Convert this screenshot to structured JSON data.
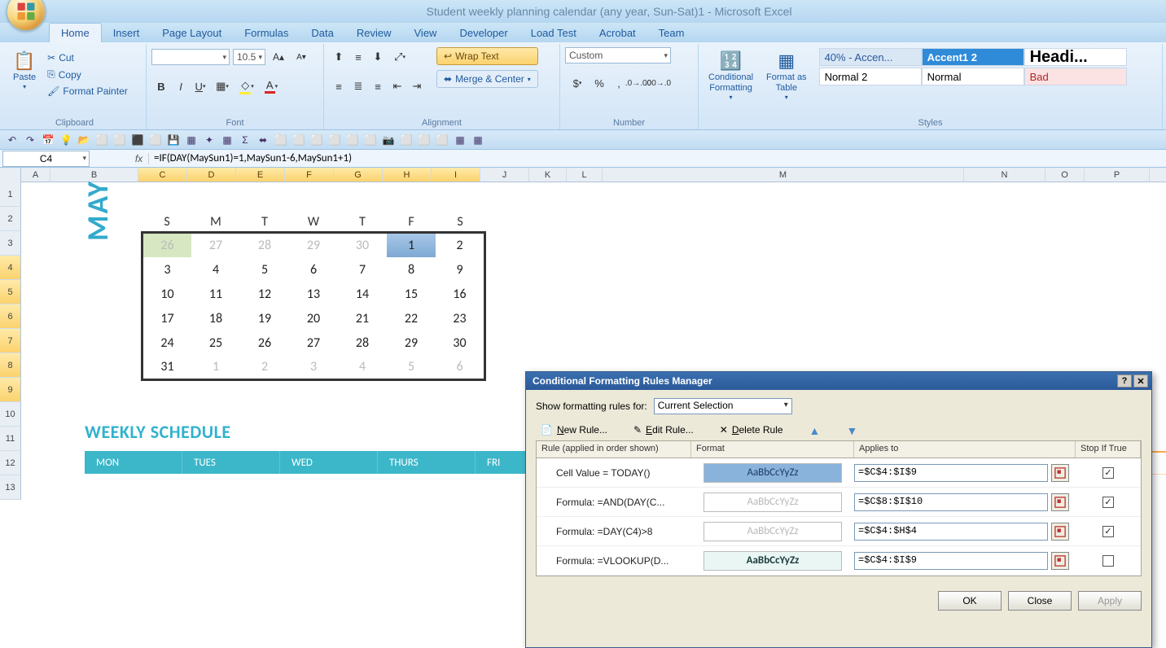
{
  "title": "Student weekly planning calendar (any year, Sun-Sat)1 - Microsoft Excel",
  "tabs": [
    "Home",
    "Insert",
    "Page Layout",
    "Formulas",
    "Data",
    "Review",
    "View",
    "Developer",
    "Load Test",
    "Acrobat",
    "Team"
  ],
  "active_tab": "Home",
  "clipboard": {
    "label": "Clipboard",
    "paste": "Paste",
    "cut": "Cut",
    "copy": "Copy",
    "fmtpainter": "Format Painter"
  },
  "font": {
    "label": "Font",
    "name": "",
    "size": "10.5"
  },
  "alignment": {
    "label": "Alignment",
    "wrap": "Wrap Text",
    "merge": "Merge & Center"
  },
  "number": {
    "label": "Number",
    "fmt": "Custom"
  },
  "stylesgrp": {
    "label": "Styles",
    "cond": "Conditional\nFormatting",
    "tbl": "Format as\nTable",
    "cells": [
      {
        "t": "40% - Accen...",
        "bg": "#d9e7f5",
        "fg": "#2b579a"
      },
      {
        "t": "Accent1 2",
        "bg": "#2f8bd8",
        "fg": "#fff",
        "bold": true
      },
      {
        "t": "Headi...",
        "bg": "#fff",
        "fg": "#000",
        "big": true,
        "bold": true
      },
      {
        "t": "Normal 2",
        "bg": "#fff",
        "fg": "#000"
      },
      {
        "t": "Normal",
        "bg": "#fff",
        "fg": "#000"
      },
      {
        "t": "Bad",
        "bg": "#fbe3e4",
        "fg": "#b02525"
      }
    ]
  },
  "namebox": "C4",
  "formula": "=IF(DAY(MaySun1)=1,MaySun1-6,MaySun1+1)",
  "cols": [
    "A",
    "B",
    "C",
    "D",
    "E",
    "F",
    "G",
    "H",
    "I",
    "J",
    "K",
    "L",
    "M",
    "N",
    "O",
    "P"
  ],
  "sel_cols": [
    "C",
    "D",
    "E",
    "F",
    "G",
    "H",
    "I"
  ],
  "rows": [
    "1",
    "2",
    "3",
    "4",
    "5",
    "6",
    "7",
    "8",
    "9",
    "10",
    "11",
    "12",
    "13"
  ],
  "sel_rows": [
    "4",
    "5",
    "6",
    "7",
    "8",
    "9"
  ],
  "month": "MAY",
  "dayhead": [
    "S",
    "M",
    "T",
    "W",
    "T",
    "F",
    "S"
  ],
  "calendar": [
    [
      {
        "n": "26",
        "dim": true,
        "sel": true
      },
      {
        "n": "27",
        "dim": true
      },
      {
        "n": "28",
        "dim": true
      },
      {
        "n": "29",
        "dim": true
      },
      {
        "n": "30",
        "dim": true
      },
      {
        "n": "1",
        "hi": true
      },
      {
        "n": "2"
      }
    ],
    [
      {
        "n": "3"
      },
      {
        "n": "4"
      },
      {
        "n": "5"
      },
      {
        "n": "6"
      },
      {
        "n": "7"
      },
      {
        "n": "8"
      },
      {
        "n": "9"
      }
    ],
    [
      {
        "n": "10"
      },
      {
        "n": "11"
      },
      {
        "n": "12"
      },
      {
        "n": "13"
      },
      {
        "n": "14"
      },
      {
        "n": "15"
      },
      {
        "n": "16"
      }
    ],
    [
      {
        "n": "17"
      },
      {
        "n": "18"
      },
      {
        "n": "19"
      },
      {
        "n": "20"
      },
      {
        "n": "21"
      },
      {
        "n": "22"
      },
      {
        "n": "23"
      }
    ],
    [
      {
        "n": "24"
      },
      {
        "n": "25"
      },
      {
        "n": "26"
      },
      {
        "n": "27"
      },
      {
        "n": "28"
      },
      {
        "n": "29"
      },
      {
        "n": "30"
      }
    ],
    [
      {
        "n": "31"
      },
      {
        "n": "1",
        "dim": true
      },
      {
        "n": "2",
        "dim": true
      },
      {
        "n": "3",
        "dim": true
      },
      {
        "n": "4",
        "dim": true
      },
      {
        "n": "5",
        "dim": true
      },
      {
        "n": "6",
        "dim": true
      }
    ]
  ],
  "weekly_title": "WEEKLY SCHEDULE",
  "weekdays": [
    "MON",
    "TUES",
    "WED",
    "THURS",
    "FRI"
  ],
  "dialog": {
    "title": "Conditional Formatting Rules Manager",
    "show_label": "Show formatting rules for:",
    "show_for": "Current Selection",
    "new": "New Rule...",
    "edit": "Edit Rule...",
    "del": "Delete Rule",
    "hdr_rule": "Rule (applied in order shown)",
    "hdr_fmt": "Format",
    "hdr_app": "Applies to",
    "hdr_stop": "Stop If True",
    "rules": [
      {
        "r": "Cell Value = TODAY()",
        "preview": "AaBbCcYyZz",
        "pbg": "#8ab3db",
        "pfg": "#1a3a66",
        "pbold": false,
        "app": "=$C$4:$I$9",
        "stop": true
      },
      {
        "r": "Formula: =AND(DAY(C...",
        "preview": "AaBbCcYyZz",
        "pbg": "#ffffff",
        "pfg": "#b8b8b8",
        "pbold": false,
        "app": "=$C$8:$I$10",
        "stop": true
      },
      {
        "r": "Formula: =DAY(C4)>8",
        "preview": "AaBbCcYyZz",
        "pbg": "#ffffff",
        "pfg": "#b8b8b8",
        "pbold": false,
        "app": "=$C$4:$H$4",
        "stop": true
      },
      {
        "r": "Formula: =VLOOKUP(D...",
        "preview": "AaBbCcYyZz",
        "pbg": "#eaf6f4",
        "pfg": "#1a3a3a",
        "pbold": true,
        "app": "=$C$4:$I$9",
        "stop": false
      }
    ],
    "ok": "OK",
    "close": "Close",
    "apply": "Apply"
  }
}
